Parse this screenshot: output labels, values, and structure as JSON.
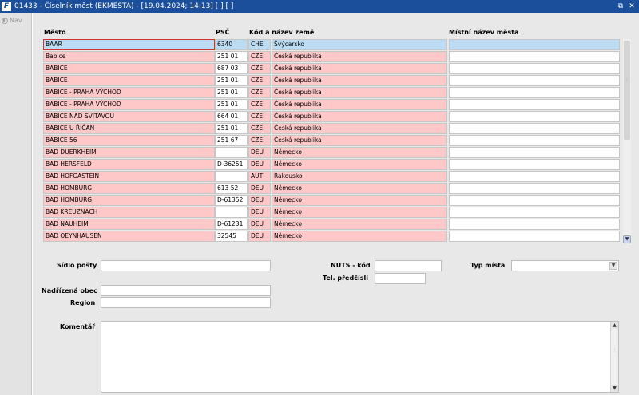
{
  "window": {
    "title": "01433 - Číselník měst (EKMESTA) - [19.04.2024; 14:13] [ ] [ ]",
    "app_icon": "F",
    "restore_glyph": "⧉",
    "close_glyph": "✕"
  },
  "nav": {
    "label": "Nav"
  },
  "columns": {
    "city": "Město",
    "psc": "PSČ",
    "country": "Kód a název země",
    "local_name": "Místní název města"
  },
  "rows": [
    {
      "city": "BAAR",
      "psc": "6340",
      "code": "CHE",
      "country": "Švýcarsko",
      "local": "",
      "selected": true
    },
    {
      "city": "Babice",
      "psc": "251 01",
      "code": "CZE",
      "country": "Česká republika",
      "local": ""
    },
    {
      "city": "BABICE",
      "psc": "687 03",
      "code": "CZE",
      "country": "Česká republika",
      "local": ""
    },
    {
      "city": "BABICE",
      "psc": "251 01",
      "code": "CZE",
      "country": "Česká republika",
      "local": ""
    },
    {
      "city": "BABICE  - PRAHA VÝCHOD",
      "psc": "251 01",
      "code": "CZE",
      "country": "Česká republika",
      "local": ""
    },
    {
      "city": "BABICE - PRAHA VÝCHOD",
      "psc": "251 01",
      "code": "CZE",
      "country": "Česká republika",
      "local": ""
    },
    {
      "city": "BABICE NAD SVITAVOU",
      "psc": "664 01",
      "code": "CZE",
      "country": "Česká republika",
      "local": ""
    },
    {
      "city": "BABICE U ŘÍČAN",
      "psc": "251 01",
      "code": "CZE",
      "country": "Česká republika",
      "local": ""
    },
    {
      "city": "BABICE 56",
      "psc": "251 67",
      "code": "CZE",
      "country": "Česká republika",
      "local": ""
    },
    {
      "city": "BAD DUERKHEIM",
      "psc": "",
      "code": "DEU",
      "country": "Německo",
      "local": ""
    },
    {
      "city": "BAD HERSFELD",
      "psc": "D-36251",
      "code": "DEU",
      "country": "Německo",
      "local": ""
    },
    {
      "city": "BAD HOFGASTEIN",
      "psc": "",
      "code": "AUT",
      "country": "Rakousko",
      "local": ""
    },
    {
      "city": "BAD HOMBURG",
      "psc": "613 52",
      "code": "DEU",
      "country": "Německo",
      "local": ""
    },
    {
      "city": "BAD HOMBURG",
      "psc": "D-61352",
      "code": "DEU",
      "country": "Německo",
      "local": ""
    },
    {
      "city": "BAD KREUZNACH",
      "psc": "",
      "code": "DEU",
      "country": "Německo",
      "local": ""
    },
    {
      "city": "BAD NAUHEIM",
      "psc": "D-61231",
      "code": "DEU",
      "country": "Německo",
      "local": ""
    },
    {
      "city": "BAD OEYNHAUSEN",
      "psc": "32545",
      "code": "DEU",
      "country": "Německo",
      "local": ""
    }
  ],
  "form": {
    "sidlo_posty": {
      "label": "Sídlo pošty",
      "value": ""
    },
    "nuts": {
      "label": "NUTS - kód",
      "value": ""
    },
    "typ_mista": {
      "label": "Typ místa",
      "value": ""
    },
    "tel_predcisli": {
      "label": "Tel. předčíslí",
      "value": ""
    },
    "nadrizena_obec": {
      "label": "Nadřízená obec",
      "value": ""
    },
    "region": {
      "label": "Region",
      "value": ""
    },
    "komentar": {
      "label": "Komentář",
      "value": ""
    }
  },
  "scroll": {
    "down_glyph": "▼",
    "up_glyph": "▲",
    "grip_glyph": "⋮"
  },
  "colors": {
    "titlebar": "#1c4f9b",
    "row_pink": "#ffc8c8",
    "row_selected": "#bcdcf4"
  }
}
